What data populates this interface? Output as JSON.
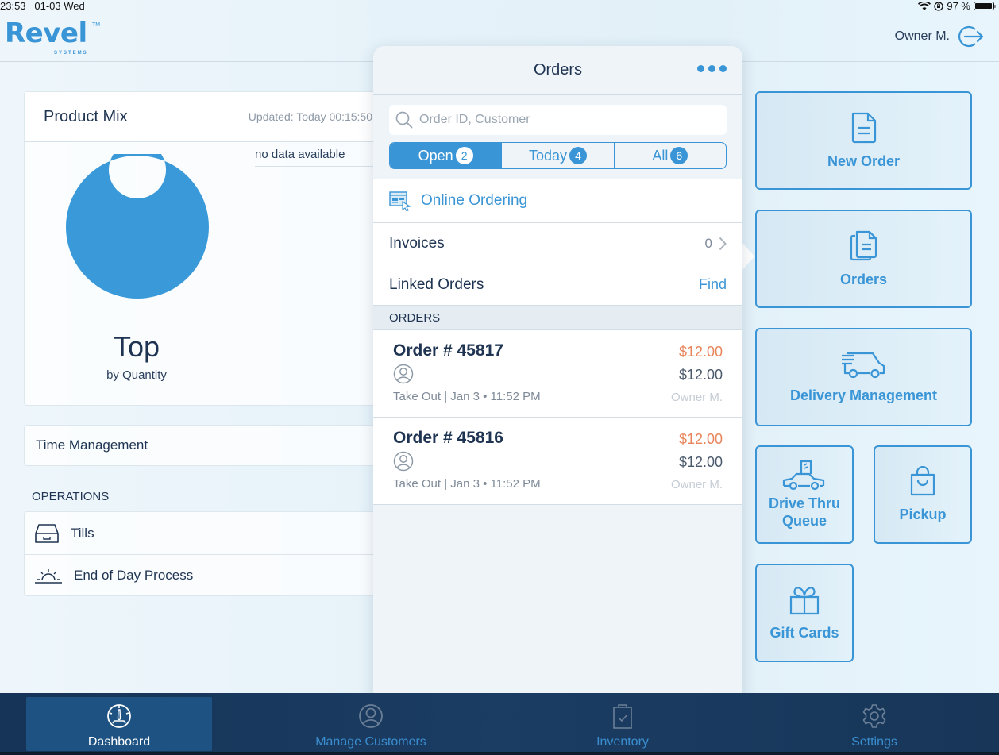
{
  "status_bar": {
    "time": "23:53",
    "date": "01-03 Wed",
    "battery": "97 %",
    "battery_level": 0.97,
    "icons": [
      "wifi-icon",
      "orientation-lock-icon",
      "battery-icon"
    ]
  },
  "header": {
    "logo_text": "Revel",
    "logo_tm": "TM",
    "logo_sub": "SYSTEMS",
    "user": "Owner M.",
    "logout_icon": "logout-icon"
  },
  "product_mix": {
    "title": "Product Mix",
    "updated": "Updated: Today 00:15:50",
    "no_data": "no data available",
    "top_label": "Top",
    "by_label": "by Quantity"
  },
  "chart_data": {
    "type": "pie",
    "title": "Product Mix",
    "subtitle": "Top by Quantity",
    "donut": true,
    "categories": [
      "(no data)"
    ],
    "values": [
      100
    ],
    "colors": [
      "#3a9ad9"
    ],
    "legend": "no data available"
  },
  "time_management": {
    "label": "Time Management"
  },
  "operations": {
    "header": "OPERATIONS",
    "items": [
      {
        "label": "Tills",
        "icon": "till-drawer-icon"
      },
      {
        "label": "End of Day Process",
        "icon": "sunset-icon"
      }
    ]
  },
  "orders_popover": {
    "title": "Orders",
    "more_icon": "more-dots-icon",
    "search_placeholder": "Order ID, Customer",
    "search_value": "",
    "segments": [
      {
        "label": "Open",
        "count": "2",
        "active": true
      },
      {
        "label": "Today",
        "count": "4",
        "active": false
      },
      {
        "label": "All",
        "count": "6",
        "active": false
      }
    ],
    "online_ordering": "Online Ordering",
    "invoices": {
      "label": "Invoices",
      "count": "0"
    },
    "linked_orders": {
      "label": "Linked Orders",
      "action": "Find"
    },
    "section_header": "ORDERS",
    "orders": [
      {
        "id": "Order # 45817",
        "due": "$12.00",
        "total": "$12.00",
        "meta": "Take Out | Jan 3 • 11:52 PM",
        "owner": "Owner M."
      },
      {
        "id": "Order # 45816",
        "due": "$12.00",
        "total": "$12.00",
        "meta": "Take Out | Jan 3 • 11:52 PM",
        "owner": "Owner M."
      }
    ]
  },
  "tiles": {
    "new_order": "New Order",
    "orders": "Orders",
    "delivery": "Delivery Management",
    "drive_thru_1": "Drive Thru",
    "drive_thru_2": "Queue",
    "pickup": "Pickup",
    "gift_cards": "Gift Cards"
  },
  "tabbar": {
    "items": [
      {
        "label": "Dashboard",
        "active": true
      },
      {
        "label": "Manage Customers",
        "active": false
      },
      {
        "label": "Inventory",
        "active": false
      },
      {
        "label": "Settings",
        "active": false
      }
    ]
  },
  "colors": {
    "accent": "#3a95d6",
    "due_amount": "#e8845a",
    "tabbar": "#1b3c63",
    "tab_active": "#1d5282"
  }
}
